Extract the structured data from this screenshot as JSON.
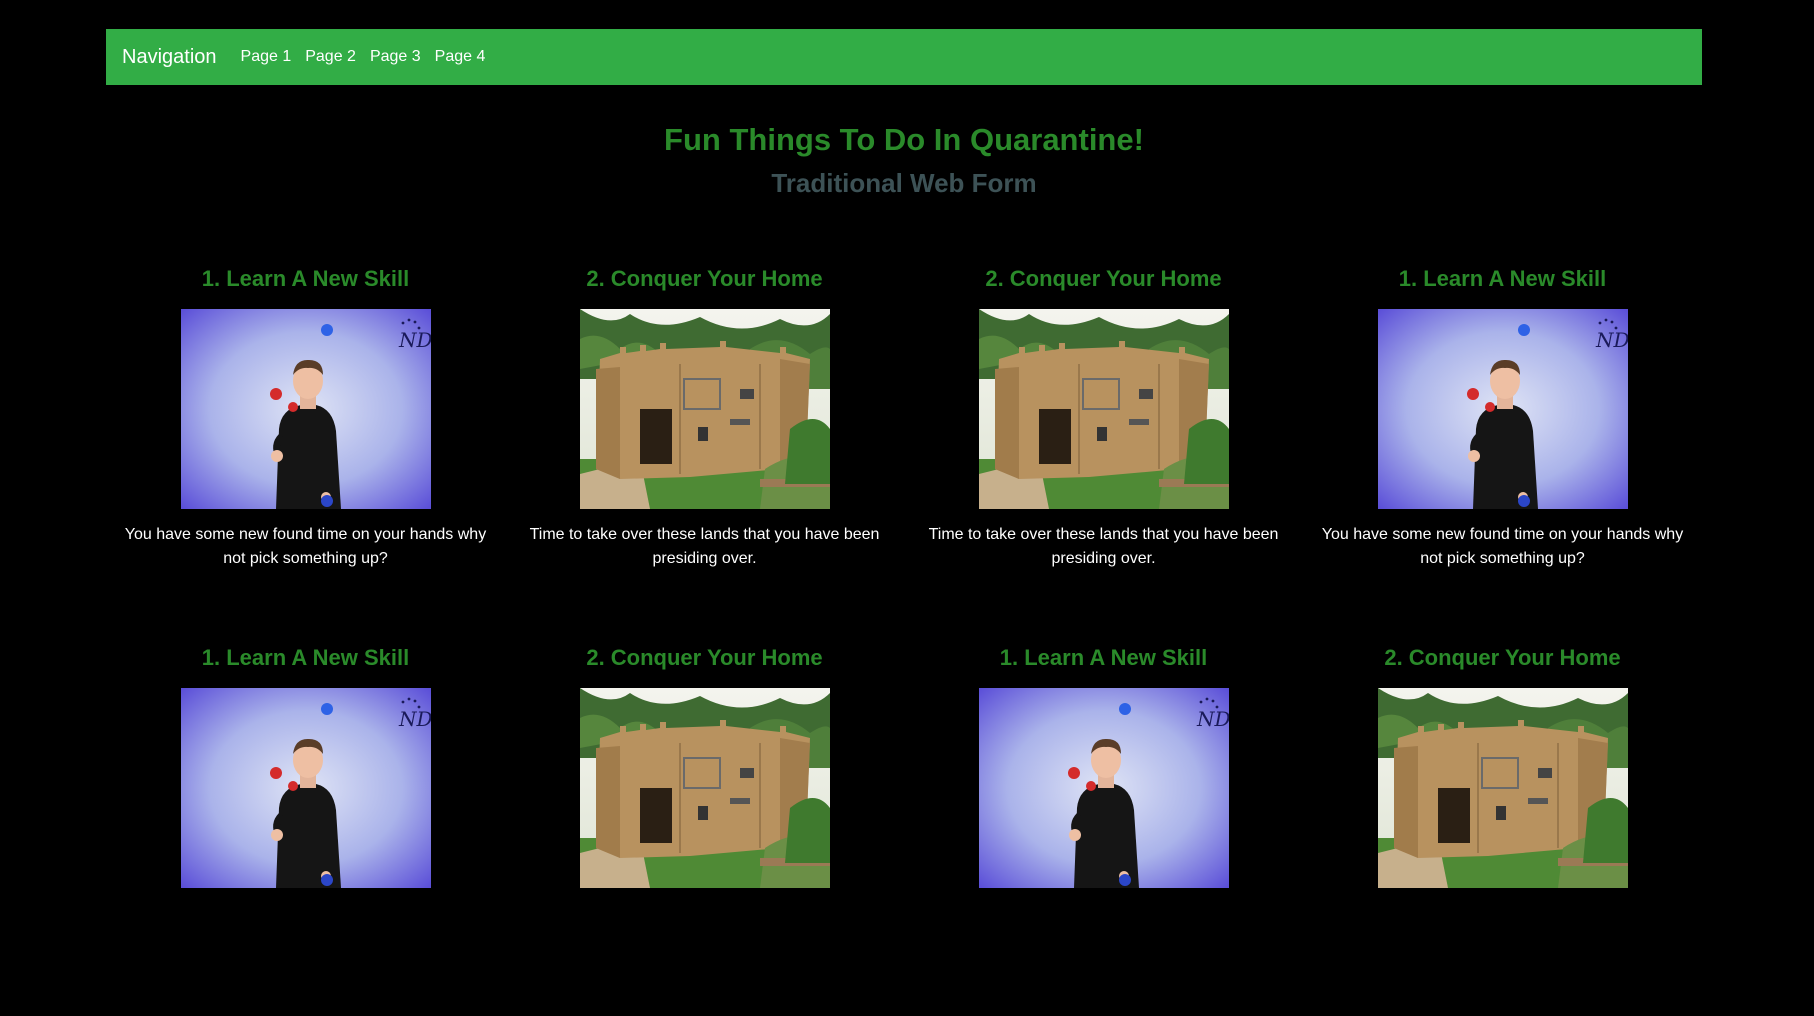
{
  "nav": {
    "brand": "Navigation",
    "links": [
      "Page 1",
      "Page 2",
      "Page 3",
      "Page 4"
    ]
  },
  "header": {
    "title": "Fun Things To Do In Quarantine!",
    "subtitle": "Traditional Web Form"
  },
  "cards": [
    {
      "title": "1. Learn A New Skill",
      "image": "juggler",
      "text": "You have some new found time on your hands why not pick something up?"
    },
    {
      "title": "2. Conquer Your Home",
      "image": "cardboard-castle",
      "text": "Time to take over these lands that you have been presiding over."
    },
    {
      "title": "2. Conquer Your Home",
      "image": "cardboard-castle",
      "text": "Time to take over these lands that you have been presiding over."
    },
    {
      "title": "1. Learn A New Skill",
      "image": "juggler",
      "text": "You have some new found time on your hands why not pick something up?"
    },
    {
      "title": "1. Learn A New Skill",
      "image": "juggler",
      "text": ""
    },
    {
      "title": "2. Conquer Your Home",
      "image": "cardboard-castle",
      "text": ""
    },
    {
      "title": "1. Learn A New Skill",
      "image": "juggler",
      "text": ""
    },
    {
      "title": "2. Conquer Your Home",
      "image": "cardboard-castle",
      "text": ""
    }
  ]
}
